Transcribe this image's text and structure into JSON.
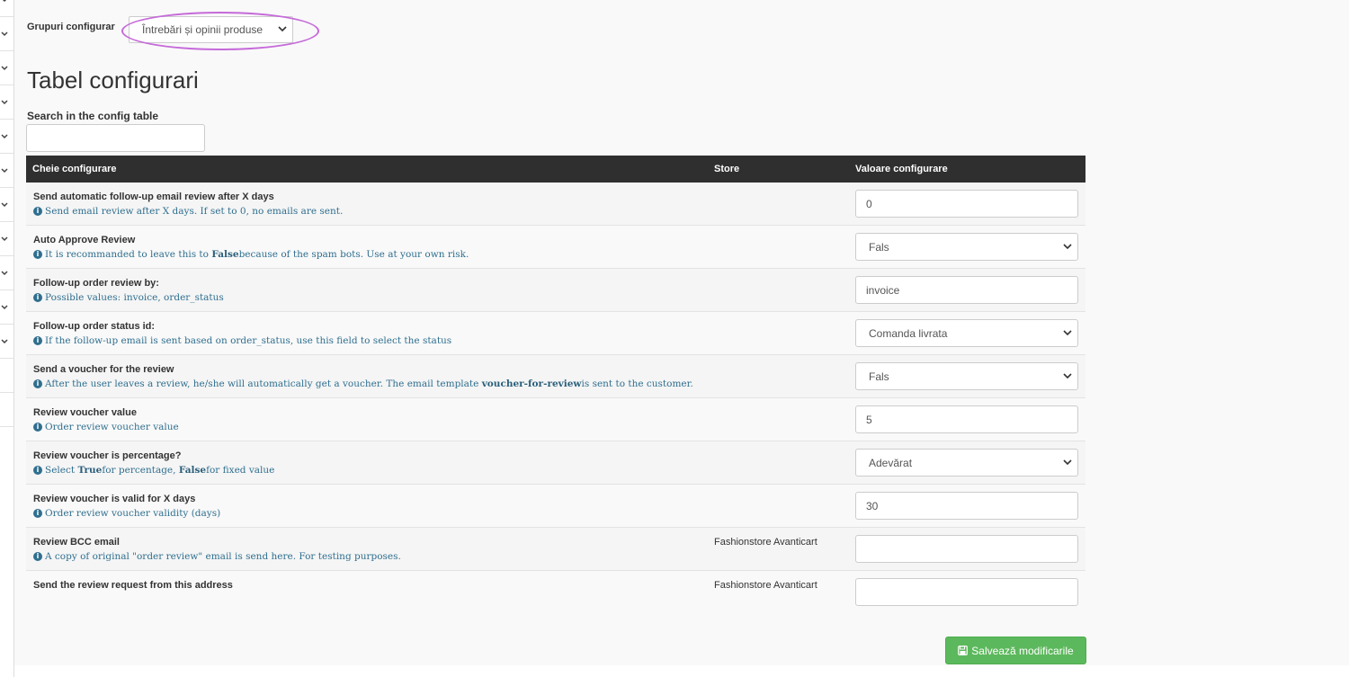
{
  "header": {
    "group_label": "Grupuri configurar",
    "group_selected": "Întrebări și opinii produse"
  },
  "page_title": "Tabel configurari",
  "search": {
    "label": "Search in the config table",
    "value": ""
  },
  "table": {
    "columns": [
      "Cheie configurare",
      "Store",
      "Valoare configurare"
    ],
    "rows": [
      {
        "title": "Send automatic follow-up email review after X days",
        "desc": "Send email review after X days. If set to 0, no emails are sent.",
        "store": "",
        "value": "0",
        "control": "input"
      },
      {
        "title": "Auto Approve Review",
        "desc_pre": "It is recommanded to leave this to ",
        "desc_bold": "False",
        "desc_post": " because of the spam bots. Use at your own risk.",
        "store": "",
        "value": "Fals",
        "control": "select"
      },
      {
        "title": "Follow-up order review by:",
        "desc": "Possible values: invoice, order_status",
        "store": "",
        "value": "invoice",
        "control": "input"
      },
      {
        "title": "Follow-up order status id:",
        "desc": "If the follow-up email is sent based on order_status, use this field to select the status",
        "store": "",
        "value": "Comanda livrata",
        "control": "select"
      },
      {
        "title": "Send a voucher for the review",
        "desc_pre": "After the user leaves a review, he/she will automatically get a voucher. The email template ",
        "desc_bold": "voucher-for-review",
        "desc_post": " is sent to the customer.",
        "store": "",
        "value": "Fals",
        "control": "select"
      },
      {
        "title": "Review voucher value",
        "desc": "Order review voucher value",
        "store": "",
        "value": "5",
        "control": "input"
      },
      {
        "title": "Review voucher is percentage?",
        "desc_pre": "Select ",
        "desc_bold": "True",
        "desc_mid": " for percentage, ",
        "desc_bold2": "False",
        "desc_post": " for fixed value",
        "store": "",
        "value": "Adevărat",
        "control": "select"
      },
      {
        "title": "Review voucher is valid for X days",
        "desc": "Order review voucher validity (days)",
        "store": "",
        "value": "30",
        "control": "input"
      },
      {
        "title": "Review BCC email",
        "desc": "A copy of original \"order review\" email is send here. For testing purposes.",
        "store": "Fashionstore Avanticart",
        "value": "",
        "control": "input"
      },
      {
        "title": "Send the review request from this address",
        "desc": "",
        "store": "Fashionstore Avanticart",
        "value": "",
        "control": "input"
      }
    ]
  },
  "save_button": "Salvează modificarile",
  "colors": {
    "header_bg": "#2f2f2f",
    "desc_text": "#2f6f8f",
    "save_button": "#5cb85c",
    "highlight_oval": "#c56ad9"
  },
  "icons": {
    "sidebar": "chevron-down-icon",
    "info": "info-circle-icon",
    "save": "floppy-disk-icon"
  }
}
